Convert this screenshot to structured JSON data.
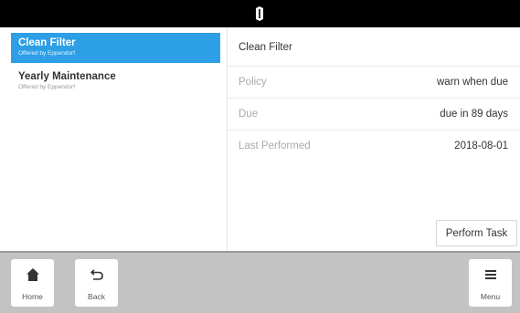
{
  "tasks": [
    {
      "title": "Clean Filter",
      "subtitle": "Offered by Eppendorf"
    },
    {
      "title": "Yearly Maintenance",
      "subtitle": "Offered by Eppendorf"
    }
  ],
  "details": {
    "title": "Clean Filter",
    "rows": [
      {
        "label": "Policy",
        "value": "warn when due"
      },
      {
        "label": "Due",
        "value": "due in 89 days"
      },
      {
        "label": "Last Performed",
        "value": "2018-08-01"
      }
    ],
    "perform_label": "Perform Task"
  },
  "bottom_nav": {
    "home_label": "Home",
    "back_label": "Back",
    "menu_label": "Menu"
  },
  "icons": {
    "logo": "eppendorf-logo-icon",
    "home": "home-icon",
    "back": "back-arrow-icon",
    "menu": "menu-icon"
  },
  "colors": {
    "topbar": "#000000",
    "selected": "#2d9fe6",
    "bottombar": "#c3c3c3"
  }
}
